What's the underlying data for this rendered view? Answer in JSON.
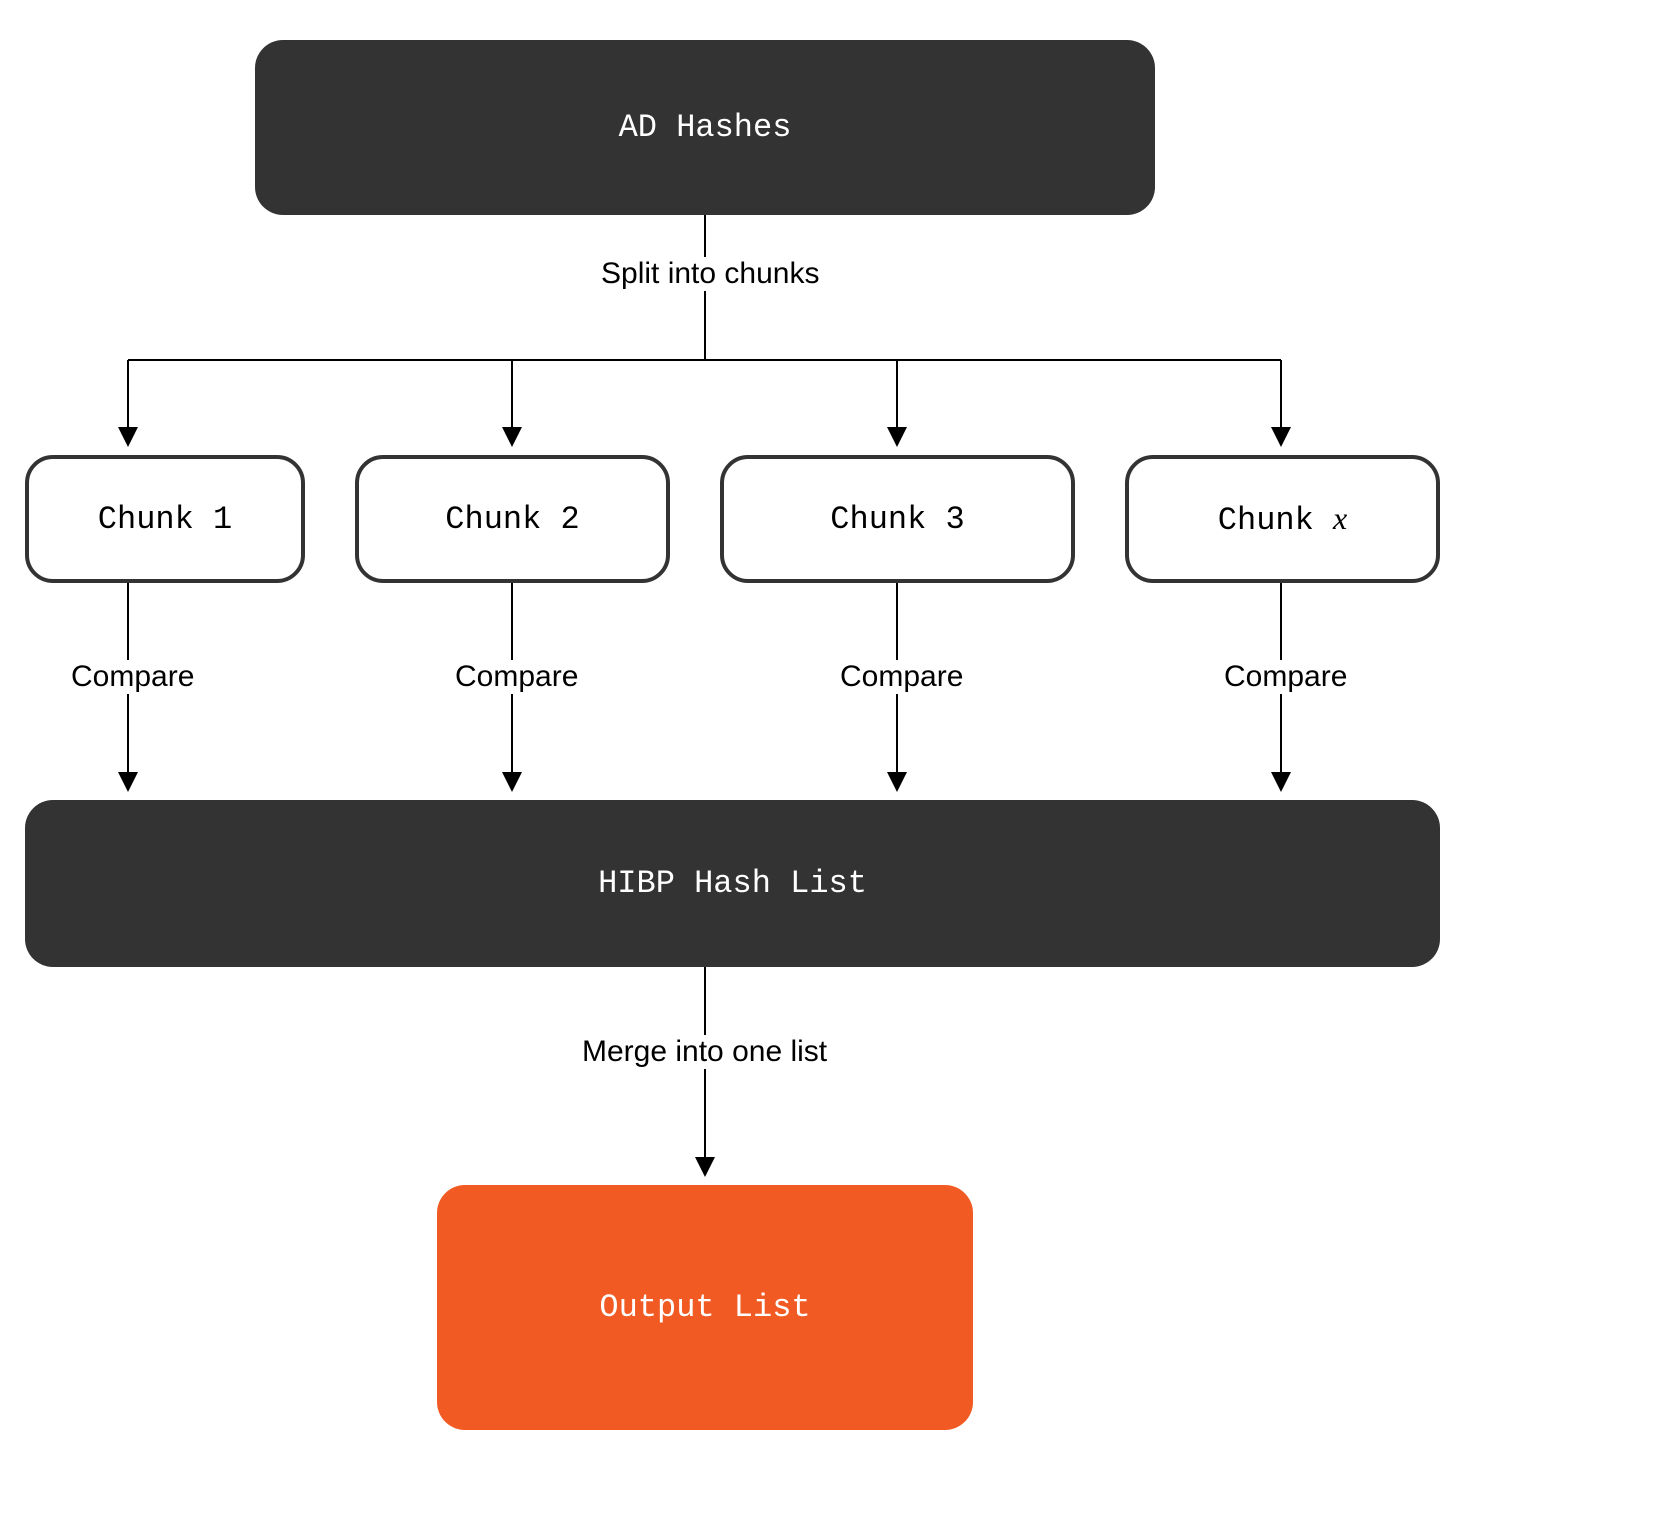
{
  "nodes": {
    "ad_hashes": "AD Hashes",
    "chunk1": "Chunk 1",
    "chunk2": "Chunk 2",
    "chunk3": "Chunk 3",
    "chunkx_prefix": "Chunk ",
    "chunkx_var": "x",
    "hibp": "HIBP Hash List",
    "output": "Output List"
  },
  "labels": {
    "split": "Split into chunks",
    "compare": "Compare",
    "merge": "Merge into one list"
  },
  "colors": {
    "dark": "#333333",
    "orange": "#F15A22",
    "white": "#FFFFFF"
  }
}
